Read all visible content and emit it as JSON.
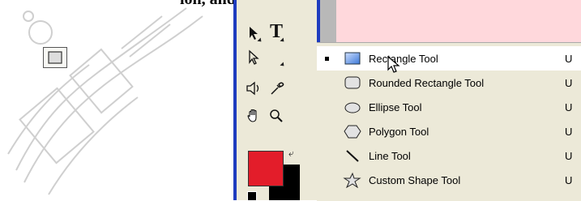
{
  "heading_fragment": "ion, and modify image.",
  "toolbox": {
    "tools": [
      {
        "id": "move",
        "icon": "move-arrow-icon"
      },
      {
        "id": "type",
        "icon": "type-tool-icon",
        "label": "T"
      },
      {
        "id": "path-selection",
        "icon": "path-selection-icon"
      },
      {
        "id": "rectangle",
        "icon": "rectangle-shape-icon"
      },
      {
        "id": "notes",
        "icon": "audio-annotation-icon"
      },
      {
        "id": "eyedropper",
        "icon": "eyedropper-icon"
      },
      {
        "id": "hand",
        "icon": "hand-icon"
      },
      {
        "id": "zoom",
        "icon": "zoom-icon"
      }
    ],
    "foreground_color": "#e31d2a",
    "background_color": "#000000"
  },
  "flyout": {
    "items": [
      {
        "label": "Rectangle Tool",
        "shortcut": "U",
        "selected": true,
        "icon": "rectangle-tool-icon"
      },
      {
        "label": "Rounded Rectangle Tool",
        "shortcut": "U",
        "selected": false,
        "icon": "rounded-rectangle-tool-icon"
      },
      {
        "label": "Ellipse Tool",
        "shortcut": "U",
        "selected": false,
        "icon": "ellipse-tool-icon"
      },
      {
        "label": "Polygon Tool",
        "shortcut": "U",
        "selected": false,
        "icon": "polygon-tool-icon"
      },
      {
        "label": "Line Tool",
        "shortcut": "U",
        "selected": false,
        "icon": "line-tool-icon"
      },
      {
        "label": "Custom Shape Tool",
        "shortcut": "U",
        "selected": false,
        "icon": "custom-shape-tool-icon"
      }
    ]
  },
  "colors": {
    "toolbar_border": "#1e3cbf",
    "panel_bg": "#ece9d8",
    "top_bar": "#ffd8dc",
    "watermark": "#c8c8c8"
  }
}
